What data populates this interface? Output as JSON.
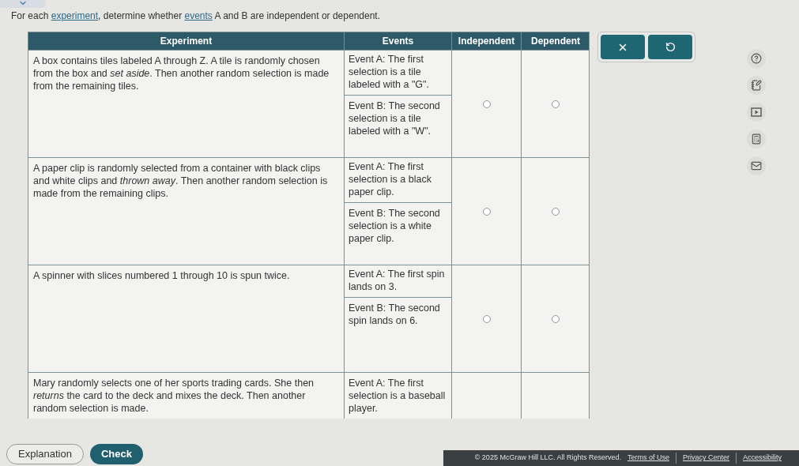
{
  "instruction": [
    {
      "kind": "text",
      "text": "For each "
    },
    {
      "kind": "link",
      "text": "experiment"
    },
    {
      "kind": "text",
      "text": ", determine whether "
    },
    {
      "kind": "link",
      "text": "events"
    },
    {
      "kind": "text",
      "text": " A and B are independent or dependent."
    }
  ],
  "table": {
    "columns": [
      "Experiment",
      "Events",
      "Independent",
      "Dependent"
    ],
    "rows": [
      {
        "experiment": "A box contains tiles labeled A through Z. A tile is randomly chosen from the box and *set aside*. Then another random selection is made from the remaining tiles.",
        "events": [
          "Event A: The first selection is a tile labeled with a \"G\".",
          "Event B: The second selection is a tile labeled with a \"W\"."
        ],
        "choices": [
          {
            "selected": false
          },
          {
            "selected": false
          }
        ]
      },
      {
        "experiment": "A paper clip is randomly selected from a container with black clips and white clips and *thrown away*. Then another random selection is made from the remaining clips.",
        "events": [
          "Event A: The first selection is a black paper clip.",
          "Event B: The second selection is a white paper clip."
        ],
        "choices": [
          {
            "selected": false
          },
          {
            "selected": false
          }
        ]
      },
      {
        "experiment": "A spinner with slices numbered 1 through 10 is spun twice.",
        "events": [
          "Event A: The first spin lands on 3.",
          "Event B: The second spin lands on 6."
        ],
        "choices": [
          {
            "selected": false
          },
          {
            "selected": false
          }
        ]
      },
      {
        "experiment": "Mary randomly selects one of her sports trading cards. She then *returns* the card to the deck and mixes the deck. Then another random selection is made.",
        "events": [
          "Event A: The first selection is a baseball player."
        ]
      }
    ]
  },
  "bottom_buttons": [
    {
      "kind": "secondary",
      "label": "Explanation"
    },
    {
      "kind": "primary",
      "label": "Check"
    }
  ],
  "footer": {
    "copyright": "© 2025 McGraw Hill LLC. All Rights Reserved.",
    "links": [
      "Terms of Use",
      "Privacy Center",
      "Accessibility"
    ]
  }
}
